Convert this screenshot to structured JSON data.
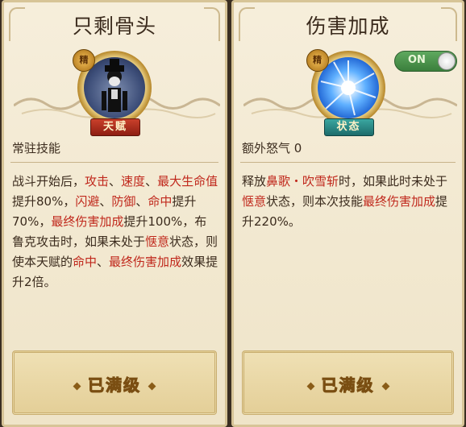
{
  "left_card": {
    "title": "只剩骨头",
    "badge": "天赋",
    "seal": "精",
    "label": "常驻技能",
    "desc_parts": [
      {
        "t": "战斗开始后，",
        "hl": false
      },
      {
        "t": "攻击",
        "hl": true
      },
      {
        "t": "、",
        "hl": false
      },
      {
        "t": "速度",
        "hl": true
      },
      {
        "t": "、",
        "hl": false
      },
      {
        "t": "最大生命值",
        "hl": true
      },
      {
        "t": "提升80%，",
        "hl": false
      },
      {
        "t": "闪避",
        "hl": true
      },
      {
        "t": "、",
        "hl": false
      },
      {
        "t": "防御",
        "hl": true
      },
      {
        "t": "、",
        "hl": false
      },
      {
        "t": "命中",
        "hl": true
      },
      {
        "t": "提升70%，",
        "hl": false
      },
      {
        "t": "最终伤害加成",
        "hl": true
      },
      {
        "t": "提升100%，布鲁克攻击时，如果未处于",
        "hl": false
      },
      {
        "t": "惬意",
        "hl": true
      },
      {
        "t": "状态，则使本天赋的",
        "hl": false
      },
      {
        "t": "命中",
        "hl": true
      },
      {
        "t": "、",
        "hl": false
      },
      {
        "t": "最终伤害加成",
        "hl": true
      },
      {
        "t": "效果提升2倍。",
        "hl": false
      }
    ],
    "button": "已满级",
    "icon": "brook-portrait"
  },
  "right_card": {
    "title": "伤害加成",
    "badge": "状态",
    "seal": "精",
    "toggle": "ON",
    "label": "额外怒气 0",
    "desc_parts": [
      {
        "t": "释放",
        "hl": false
      },
      {
        "t": "鼻歌・吹雪斩",
        "hl": true
      },
      {
        "t": "时，如果此时未处于",
        "hl": false
      },
      {
        "t": "惬意",
        "hl": true
      },
      {
        "t": "状态，则本次技能",
        "hl": false
      },
      {
        "t": "最终伤害加成",
        "hl": true
      },
      {
        "t": "提升220%。",
        "hl": false
      }
    ],
    "button": "已满级",
    "icon": "blue-burst"
  },
  "colors": {
    "highlight": "#c0281c",
    "card_bg": "#f6eedb",
    "toggle_on": "#4f9a50"
  }
}
